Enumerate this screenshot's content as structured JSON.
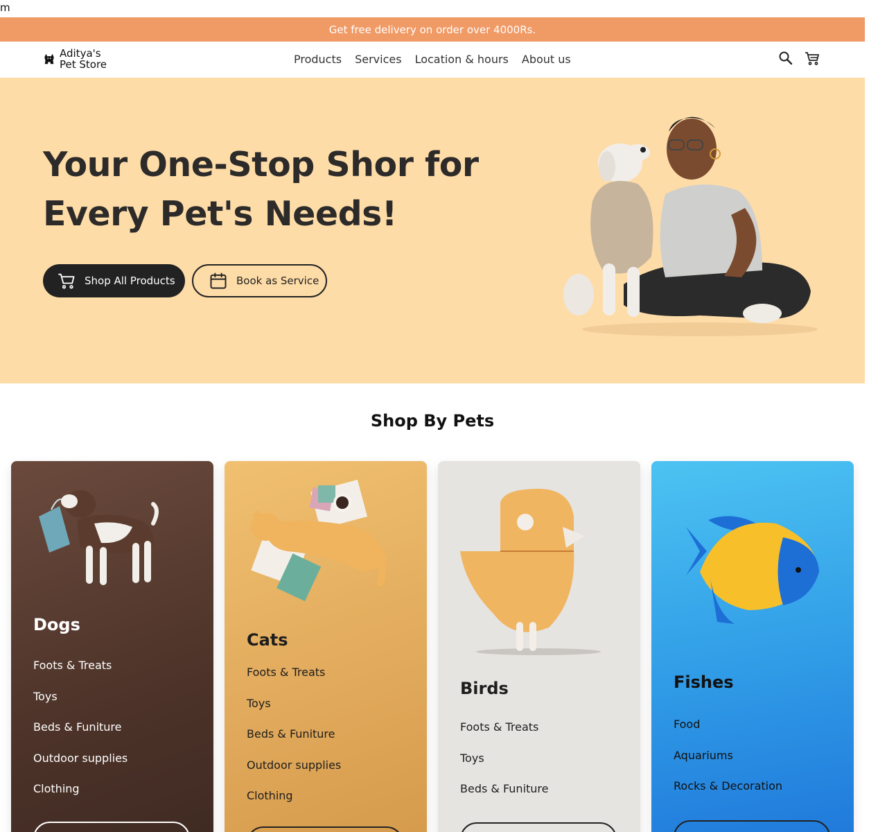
{
  "stray_text": "m",
  "promo": {
    "text": "Get free delivery on order over 4000Rs."
  },
  "nav": {
    "logo_line1": "Aditya's",
    "logo_line2": "Pet Store",
    "links": [
      "Products",
      "Services",
      "Location & hours",
      "About us"
    ],
    "icons": [
      "search-icon",
      "cart-icon"
    ]
  },
  "hero": {
    "title_line1": "Your One-Stop Shor for",
    "title_line2": "Every Pet's Needs!",
    "primary_button": "Shop All Products",
    "secondary_button": "Book as Service",
    "colors": {
      "background": "#fedca8",
      "button_dark": "#222222"
    }
  },
  "shop_by_pets": {
    "title": "Shop By Pets",
    "cards": [
      {
        "title": "Dogs",
        "items": [
          "Foots & Treats",
          "Toys",
          "Beds & Funiture",
          "Outdoor supplies",
          "Clothing"
        ],
        "color": "#5a3d31"
      },
      {
        "title": "Cats",
        "items": [
          "Foots & Treats",
          "Toys",
          "Beds & Funiture",
          "Outdoor supplies",
          "Clothing"
        ],
        "color": "#e3ac5e"
      },
      {
        "title": "Birds",
        "items": [
          "Foots & Treats",
          "Toys",
          "Beds & Funiture"
        ],
        "color": "#e6e4e1"
      },
      {
        "title": "Fishes",
        "items": [
          "Food",
          "Aquariums",
          "Rocks & Decoration"
        ],
        "color": "#2f9ae6"
      }
    ]
  }
}
